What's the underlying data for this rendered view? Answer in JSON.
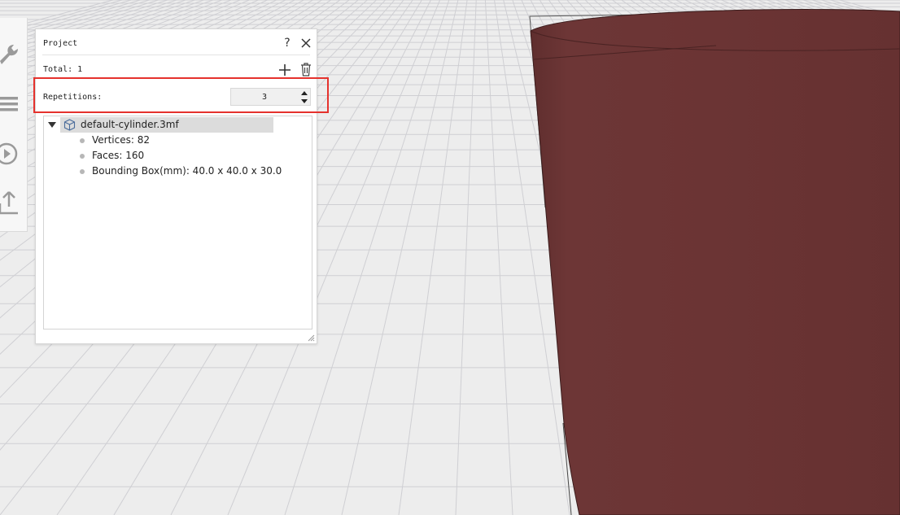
{
  "panel": {
    "title": "Project",
    "total_label": "Total: 1",
    "repetitions_label": "Repetitions:",
    "repetitions_value": "3"
  },
  "tree": {
    "root_label": "default-cylinder.3mf",
    "items": [
      {
        "label": "Vertices: 82"
      },
      {
        "label": "Faces: 160"
      },
      {
        "label": "Bounding Box(mm): 40.0 x 40.0 x 30.0"
      }
    ]
  },
  "colors": {
    "highlight": "#e5322d",
    "model": "#6a3434",
    "grid_background": "#ededed",
    "grid_line": "#cfcfd3"
  },
  "icons": {
    "toolbar": [
      "wrench-icon",
      "menu-icon",
      "play-icon",
      "upload-icon"
    ],
    "panel": [
      "help-icon",
      "close-icon",
      "plus-icon",
      "trash-icon",
      "cube-icon",
      "expand-triangle-icon",
      "spin-up-icon",
      "spin-down-icon"
    ]
  }
}
